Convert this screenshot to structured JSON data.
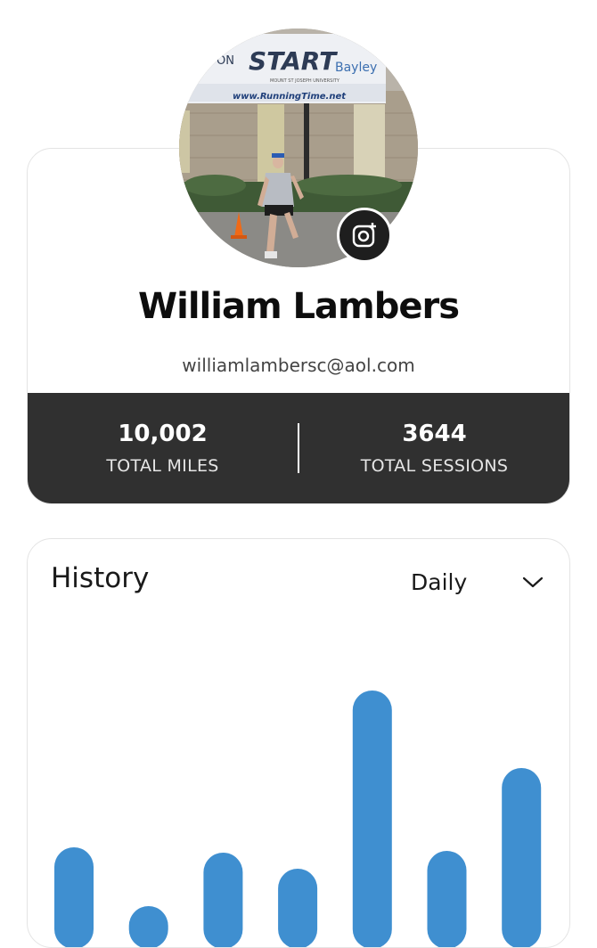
{
  "profile": {
    "name": "William Lambers",
    "email": "williamlambersc@aol.com",
    "avatar_icon": "avatar-photo",
    "camera_icon": "instagram-add-icon",
    "stats": [
      {
        "value": "10,002",
        "label": "TOTAL MILES"
      },
      {
        "value": "3644",
        "label": "TOTAL SESSIONS"
      }
    ],
    "photo_banner": {
      "start": "START",
      "sponsor": "Bayley",
      "url": "www.RunningTime.net",
      "university": "MOUNT ST JOSEPH UNIVERSITY",
      "left_partial": "ON"
    }
  },
  "history": {
    "title": "History",
    "period": "Daily",
    "chevron_icon": "chevron-down-icon"
  },
  "colors": {
    "bar": "#3f8fd0",
    "stats_bg": "#303030"
  },
  "chart_data": {
    "type": "bar",
    "values": [
      74,
      2,
      68,
      50,
      250,
      70,
      163
    ]
  }
}
